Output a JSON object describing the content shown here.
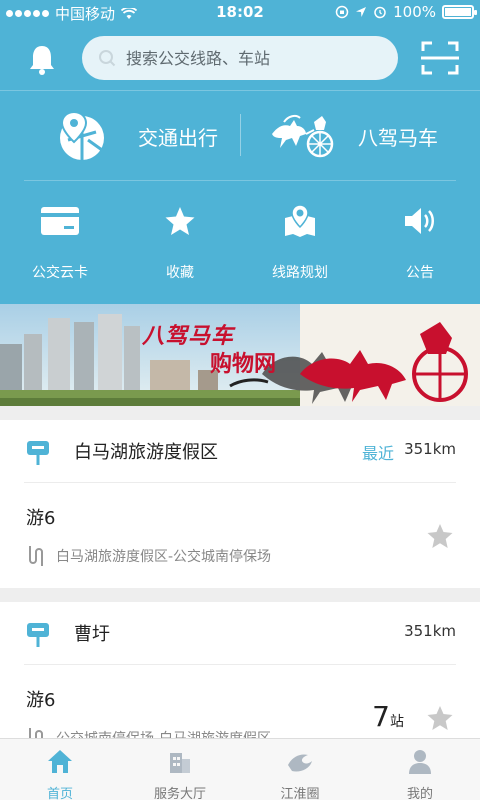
{
  "status_bar": {
    "carrier": "中国移动",
    "time": "18:02",
    "battery": "100%"
  },
  "search": {
    "placeholder": "搜索公交线路、车站"
  },
  "features": [
    {
      "label": "交通出行",
      "icon": "map-location-icon"
    },
    {
      "label": "八驾马车",
      "icon": "chariot-logo"
    }
  ],
  "quick_actions": [
    {
      "label": "公交云卡",
      "icon": "card-icon"
    },
    {
      "label": "收藏",
      "icon": "star-icon"
    },
    {
      "label": "线路规划",
      "icon": "map-pin-icon"
    },
    {
      "label": "公告",
      "icon": "speaker-icon"
    }
  ],
  "banner": {
    "title": "八驾马车",
    "subtitle": "购物网"
  },
  "cards": [
    {
      "stop_name": "白马湖旅游度假区",
      "recent_tag": "最近",
      "distance": "351km",
      "route": "游6",
      "path": "白马湖旅游度假区-公交城南停保场"
    },
    {
      "stop_name": "曹圩",
      "distance": "351km",
      "route": "游6",
      "path": "公交城南停保场-白马湖旅游度假区",
      "stations_count": "7",
      "stations_unit": "站"
    }
  ],
  "tabs": [
    {
      "label": "首页",
      "icon": "home-icon",
      "active": true
    },
    {
      "label": "服务大厅",
      "icon": "building-icon",
      "active": false
    },
    {
      "label": "江淮圈",
      "icon": "wave-icon",
      "active": false
    },
    {
      "label": "我的",
      "icon": "user-icon",
      "active": false
    }
  ],
  "colors": {
    "accent": "#4fb3d6",
    "banner_red": "#c8102e"
  }
}
